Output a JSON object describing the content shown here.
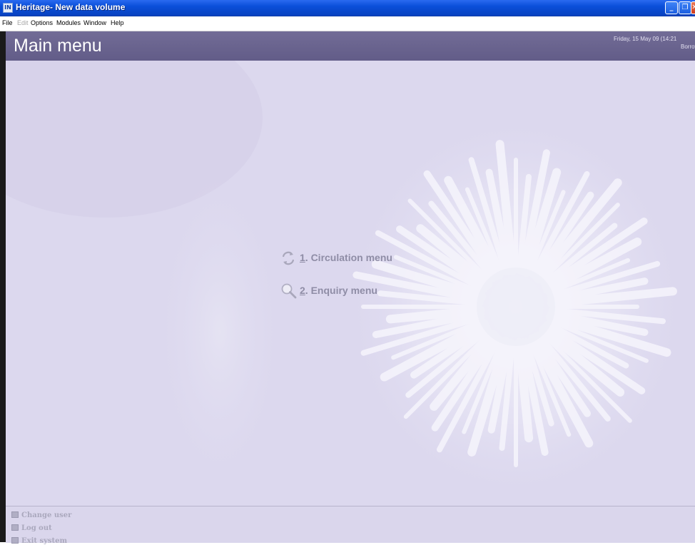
{
  "window": {
    "icon_text": "IN",
    "title": "Heritage- New data volume",
    "controls": {
      "minimize": "_",
      "maximize": "❐",
      "close": "✕"
    }
  },
  "menubar": {
    "items": [
      {
        "label": "File",
        "enabled": true
      },
      {
        "label": "Edit",
        "enabled": false
      },
      {
        "label": "Options",
        "enabled": true
      },
      {
        "label": "Modules",
        "enabled": true
      },
      {
        "label": "Window",
        "enabled": true
      },
      {
        "label": "Help",
        "enabled": true
      }
    ]
  },
  "header": {
    "title": "Main menu",
    "date": "Friday, 15 May 09  (14:21",
    "mode": "Borrow"
  },
  "menu_options": [
    {
      "number": "1",
      "label": ". Circulation menu",
      "icon": "refresh-icon"
    },
    {
      "number": "2",
      "label": ". Enquiry menu",
      "icon": "magnifier-icon"
    }
  ],
  "footer": {
    "items": [
      {
        "label": "Change user",
        "icon": "user-icon"
      },
      {
        "label": "Log out",
        "icon": "logout-icon"
      },
      {
        "label": "Exit system",
        "icon": "exit-icon"
      }
    ]
  },
  "colors": {
    "titlebar": "#0a4fd9",
    "header": "#6a6490",
    "background": "#dedaf0",
    "option_text": "#8f8da6"
  }
}
